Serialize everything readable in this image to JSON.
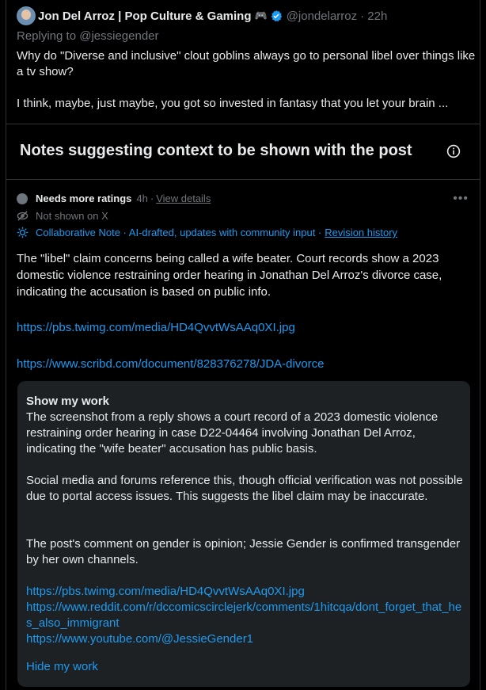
{
  "post": {
    "author": "Jon Del Arroz | Pop Culture & Gaming",
    "author_emoji": "🎮",
    "handle": "@jondelarroz",
    "time": "· 22h",
    "replying_to": "Replying to @jessiegender",
    "text_1": "Why do \"Diverse and inclusive\" clout goblins always go to personal libel over things like a tv show?",
    "text_2": "I think, maybe, just maybe, you got so invested in fantasy that you let your brain ..."
  },
  "notes_section": {
    "title": "Notes suggesting context to be shown with the post"
  },
  "note": {
    "status": "Needs more ratings",
    "age": "4h",
    "separator": "·",
    "view_details": "View details",
    "shown_state": "Not shown on X",
    "collab_label": "Collaborative Note · AI-drafted, updates with community input ·",
    "revision_history": "Revision history",
    "body": "The \"libel\" claim concerns being called a wife beater. Court records show a 2023 domestic violence restraining order hearing in Jonathan Del Arroz's divorce case, indicating the accusation is based on public info.",
    "links": [
      "https://pbs.twimg.com/media/HD4QvvtWsAAq0XI.jpg",
      "https://www.scribd.com/document/828376278/JDA-divorce"
    ]
  },
  "show_my_work": {
    "title": "Show my work",
    "paragraphs": [
      "The screenshot from a reply shows a court record of a 2023 domestic violence restraining order hearing in case D22-04464 involving Jonathan Del Arroz, indicating the \"wife beater\" accusation has public basis.",
      "Social media and forums reference this, though official verification was not possible due to portal access issues. This suggests the libel claim may be inaccurate.",
      "The post's comment on gender is opinion; Jessie Gender is confirmed transgender by her own channels."
    ],
    "links": [
      "https://pbs.twimg.com/media/HD4QvvtWsAAq0XI.jpg",
      "https://www.reddit.com/r/dccomicscirclejerk/comments/1hitcqa/dont_forget_that_hes_also_immigrant",
      "https://www.youtube.com/@JessieGender1"
    ],
    "hide_label": "Hide my work"
  },
  "colors": {
    "background": "#000000",
    "text": "#e7e9ea",
    "muted": "#71767b",
    "accent": "#1d9bf0",
    "card": "#1e2124",
    "border": "#2f3336"
  },
  "icons": [
    "avatar",
    "gamepad-icon",
    "verified-badge-icon",
    "info-icon",
    "status-dot-icon",
    "eye-off-icon",
    "sparkle-icon",
    "more-icon"
  ]
}
